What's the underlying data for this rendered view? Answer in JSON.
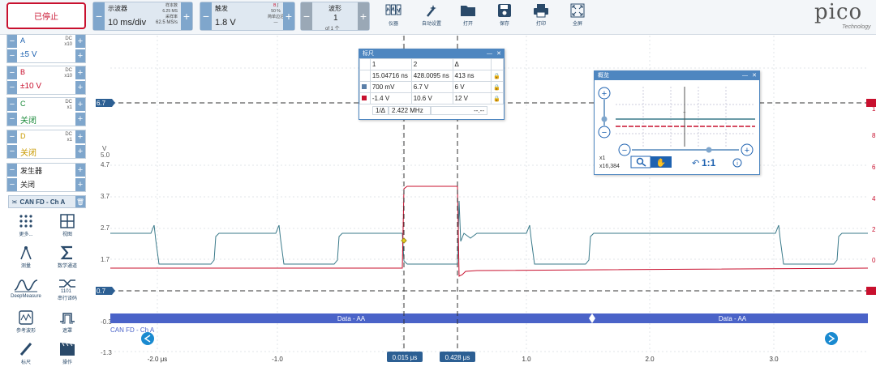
{
  "toolbar": {
    "stop_label": "已停止",
    "timebase": {
      "title": "示波器",
      "value": "10 ms/div",
      "samples_label": "样本数",
      "samples": "6.25 MS",
      "rate_label": "采样率",
      "rate": "62.5 MS/s"
    },
    "trigger": {
      "title": "触发",
      "value": "1.8 V",
      "pct": "50 %",
      "mode": "简单边沿",
      "dash": "—"
    },
    "waveform": {
      "title": "波形",
      "value": "1",
      "count": "1 个"
    },
    "buttons": [
      {
        "label": "仪器",
        "icon": "instrument-icon"
      },
      {
        "label": "自动设置",
        "icon": "auto-setup-icon"
      },
      {
        "label": "打开",
        "icon": "open-folder-icon"
      },
      {
        "label": "保存",
        "icon": "save-icon"
      },
      {
        "label": "打印",
        "icon": "print-icon"
      },
      {
        "label": "全屏",
        "icon": "fullscreen-icon"
      }
    ],
    "logo": "pico",
    "logo_sub": "Technology"
  },
  "channels": [
    {
      "name": "A",
      "coupling": "DC",
      "probe": "x10",
      "value": "±5 V",
      "color": "#1e62b0"
    },
    {
      "name": "B",
      "coupling": "DC",
      "probe": "x10",
      "value": "±10 V",
      "color": "#c8102e"
    },
    {
      "name": "C",
      "coupling": "DC",
      "probe": "x1",
      "value": "关闭",
      "color": "#1a8a3a"
    },
    {
      "name": "D",
      "coupling": "DC",
      "probe": "x1",
      "value": "关闭",
      "color": "#c89a00"
    }
  ],
  "generator": {
    "title": "发生器",
    "value": "关闭"
  },
  "decoder_tab": "CAN FD - Ch A",
  "tools": [
    {
      "label": "更多...",
      "icon": "more-grid-icon"
    },
    {
      "label": "视图",
      "icon": "view-grid-icon"
    },
    {
      "label": "测量",
      "icon": "measure-icon"
    },
    {
      "label": "数学通道",
      "icon": "math-sigma-icon"
    },
    {
      "label": "DeepMeasure",
      "icon": "deepmeasure-icon"
    },
    {
      "label": "串行译码",
      "icon": "serial-decode-icon"
    },
    {
      "label": "参考波形",
      "icon": "reference-waveform-icon"
    },
    {
      "label": "遮罩",
      "icon": "mask-icon"
    },
    {
      "label": "标尺",
      "icon": "ruler-icon"
    },
    {
      "label": "操作",
      "icon": "action-icon"
    }
  ],
  "scope": {
    "y_unit": "V",
    "y_ticks": [
      "5.0",
      "4.7",
      "3.7",
      "2.7",
      "1.7",
      "-0.3",
      "-1.3"
    ],
    "right_ticks": [
      "1",
      "8",
      "6",
      "4",
      "2",
      "0"
    ],
    "x_ticks": [
      "-2.0 μs",
      "-1.0",
      "0.0",
      "1.0",
      "2.0",
      "3.0"
    ],
    "hcursor_top": "6.7",
    "hcursor_bottom": "0.7",
    "vcursor_1": "0.015 μs",
    "vcursor_2": "0.428 μs",
    "decode_label": "Data - AA",
    "decode_channel": "CAN FD - Ch A",
    "colors": {
      "ch_a": "#3a7a8a",
      "ch_b": "#c8102e",
      "decode": "#4a63c8"
    }
  },
  "ruler_window": {
    "title": "标尺",
    "headers": [
      "",
      "1",
      "2",
      "Δ"
    ],
    "rows": [
      {
        "swatch": "",
        "c1": "15.04716 ns",
        "c2": "428.0095 ns",
        "d": "413 ns"
      },
      {
        "swatch": "#5b7fa8",
        "c1": "700 mV",
        "c2": "6.7 V",
        "d": "6 V"
      },
      {
        "swatch": "#c8102e",
        "c1": "-1.4 V",
        "c2": "10.6 V",
        "d": "12 V"
      }
    ],
    "freq_label": "1/Δ",
    "freq": "2.422 MHz",
    "freq_extra": "--.--"
  },
  "overview": {
    "title": "概览",
    "zoom_x": "x1",
    "zoom_y": "x16,384",
    "ratio": "1:1"
  }
}
